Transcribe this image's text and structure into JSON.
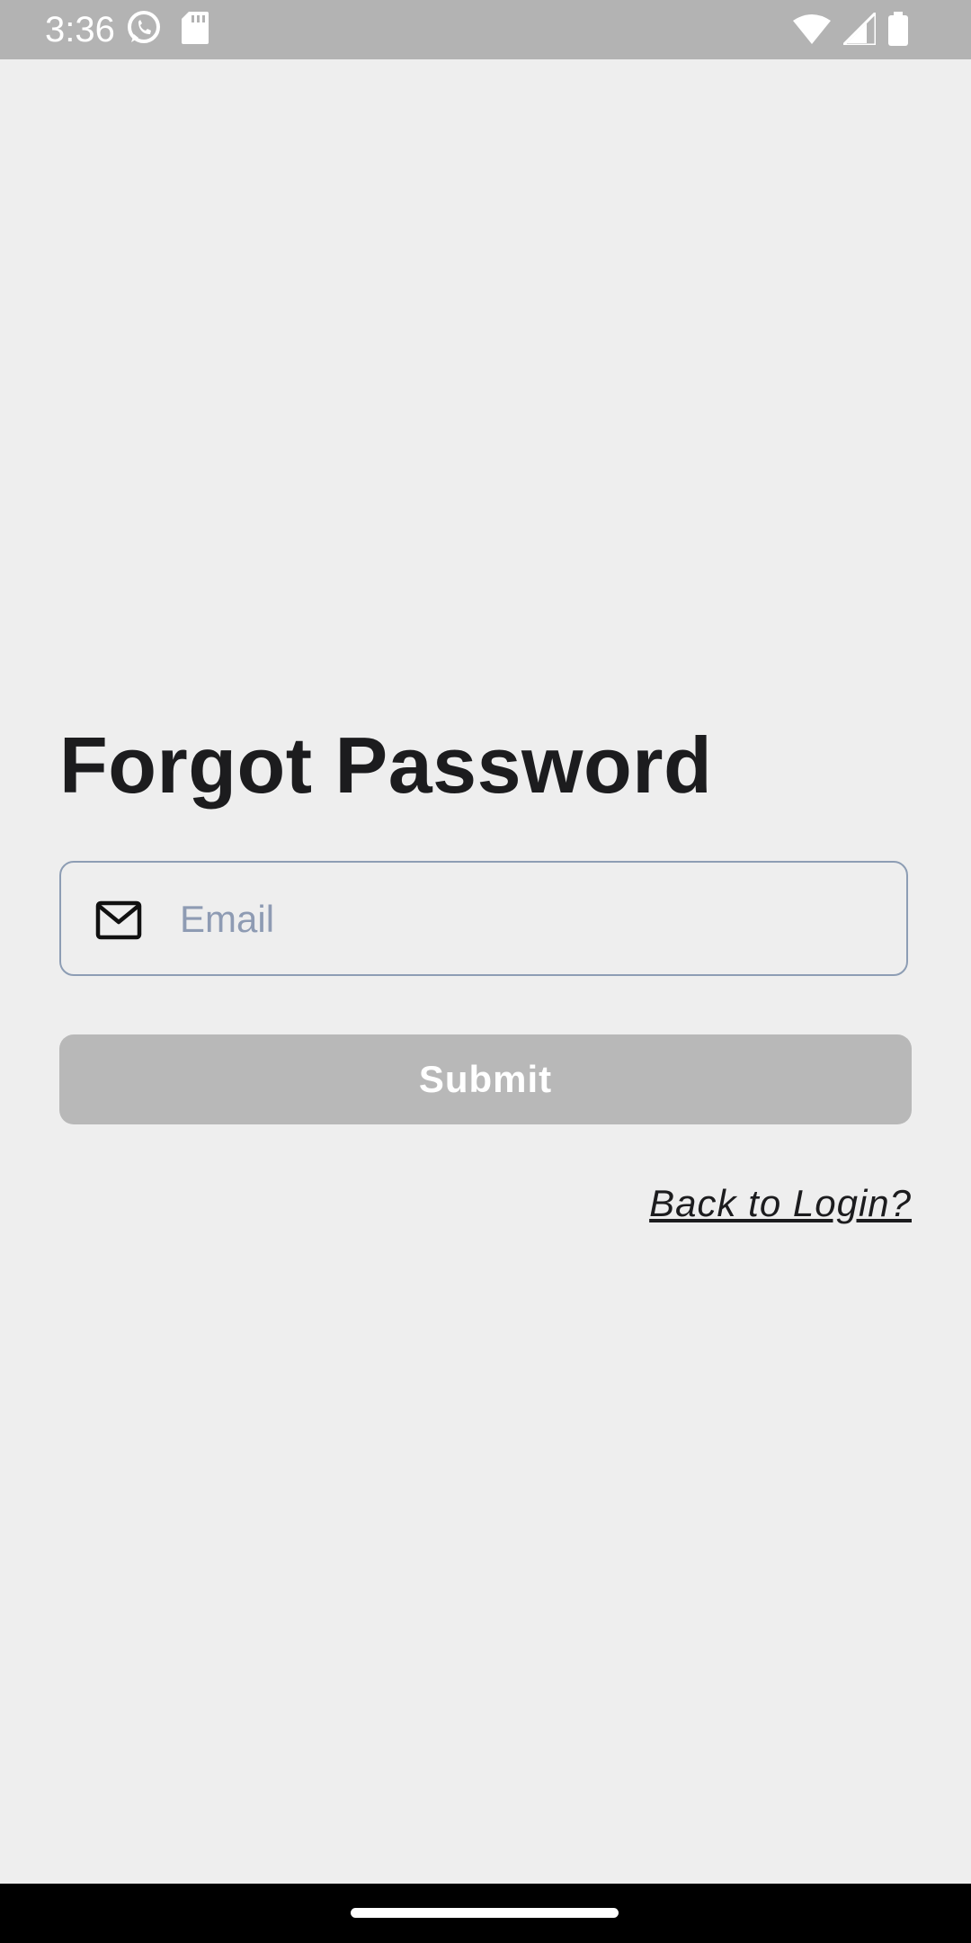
{
  "status_bar": {
    "time": "3:36",
    "left_icons": [
      "whatsapp-icon",
      "sd-card-icon"
    ],
    "right_icons": [
      "wifi-icon",
      "cell-signal-icon",
      "battery-icon"
    ]
  },
  "form": {
    "title": "Forgot Password",
    "email": {
      "placeholder": "Email",
      "value": "",
      "icon": "mail-icon"
    },
    "submit_label": "Submit",
    "back_link_label": "Back to Login?"
  },
  "colors": {
    "background": "#eeeeee",
    "status_bar": "#b3b3b3",
    "title_text": "#1c1c1e",
    "field_border": "#8d9db4",
    "placeholder": "#8e9bb3",
    "submit_bg_disabled": "#b8b8b8",
    "submit_text": "#ffffff",
    "nav_bar": "#000000"
  }
}
